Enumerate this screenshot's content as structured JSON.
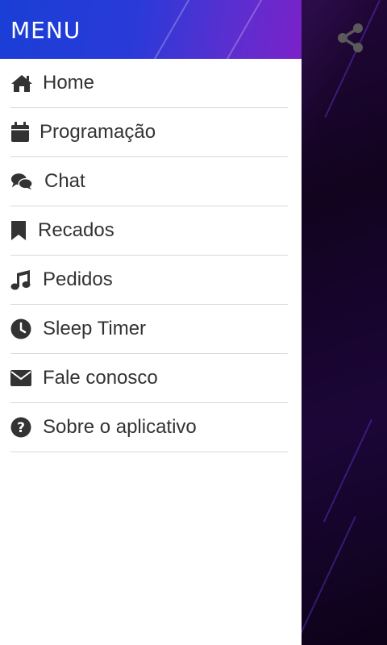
{
  "drawer": {
    "title": "MENU",
    "items": [
      {
        "label": "Home",
        "icon": "home-icon"
      },
      {
        "label": "Programação",
        "icon": "calendar-icon"
      },
      {
        "label": "Chat",
        "icon": "chat-icon"
      },
      {
        "label": "Recados",
        "icon": "bookmark-icon"
      },
      {
        "label": "Pedidos",
        "icon": "music-icon"
      },
      {
        "label": "Sleep Timer",
        "icon": "clock-icon"
      },
      {
        "label": "Fale conosco",
        "icon": "envelope-icon"
      },
      {
        "label": "Sobre o aplicativo",
        "icon": "question-circle-icon"
      }
    ]
  },
  "actions": {
    "share_icon": "share-icon"
  },
  "colors": {
    "header_start": "#1a3fd6",
    "header_end": "#7a22c8",
    "menu_text": "#333333",
    "background": "#1a0630"
  }
}
